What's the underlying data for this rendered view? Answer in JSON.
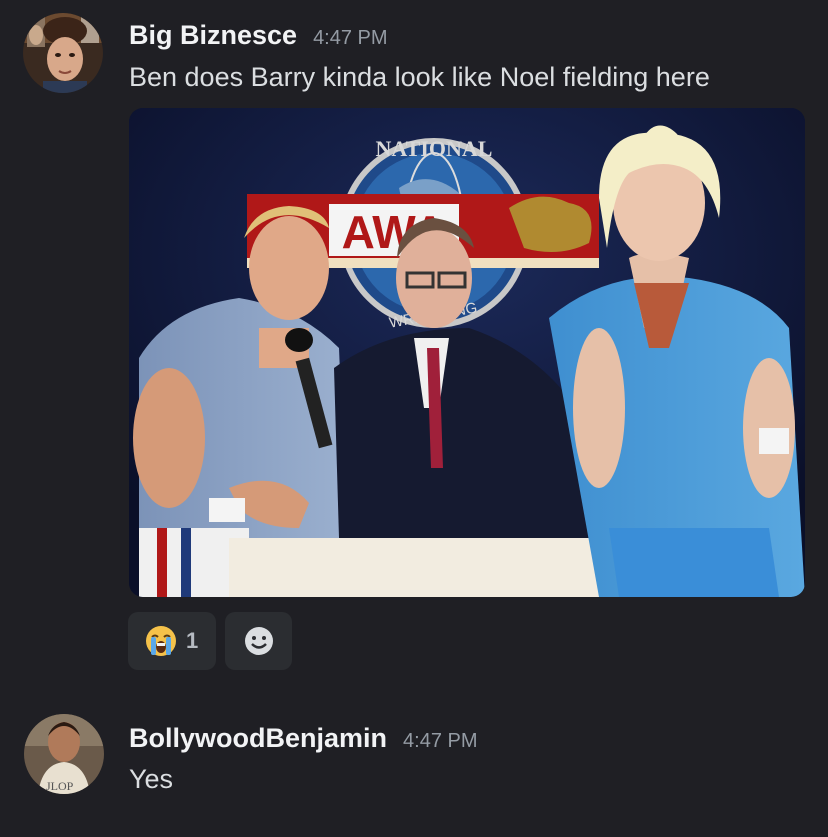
{
  "messages": [
    {
      "username": "Big Biznesce",
      "timestamp": "4:47 PM",
      "text": "Ben does Barry kinda look like Noel fielding here",
      "attachment": {
        "type": "image",
        "logo_text": "NATIONAL",
        "sign_text": "AWA",
        "ring_text": "WRESTLING"
      },
      "reactions": [
        {
          "emoji": "loudly-crying-face",
          "count": "1"
        }
      ]
    },
    {
      "username": "BollywoodBenjamin",
      "timestamp": "4:47 PM",
      "text": "Yes"
    }
  ],
  "colors": {
    "background": "#1f1f24",
    "username": "#f2f3f5",
    "timestamp": "#949ba4",
    "text": "#dbdee1",
    "reaction_bg": "#2b2d31"
  }
}
